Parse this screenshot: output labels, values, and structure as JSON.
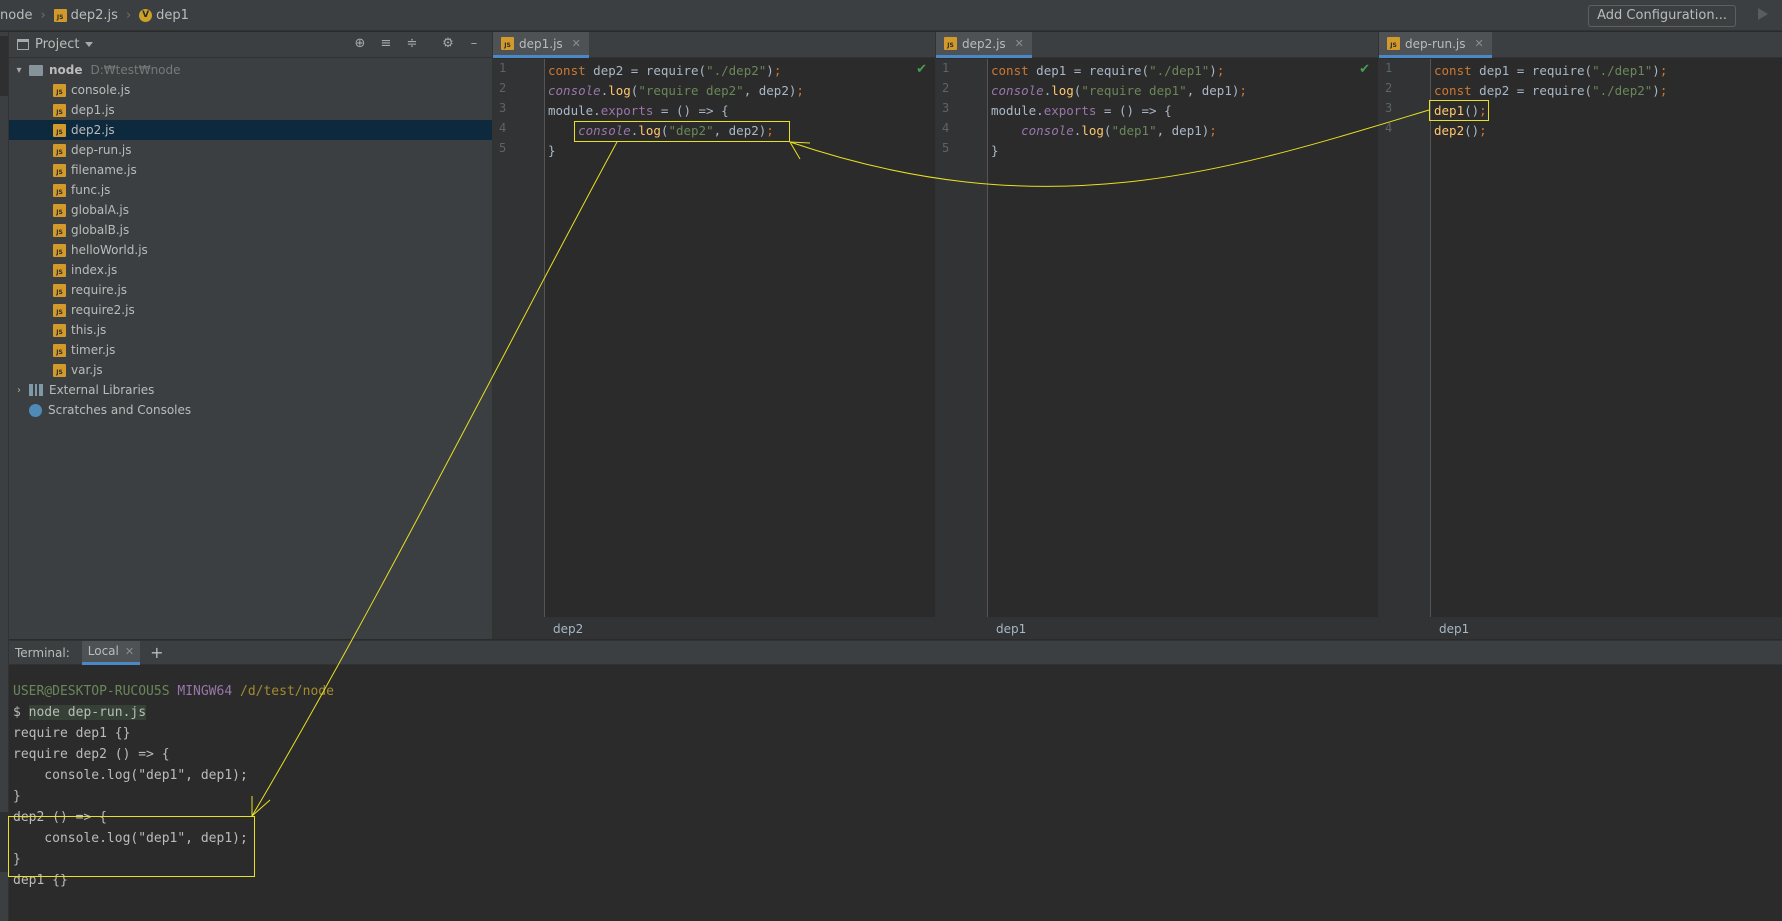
{
  "nav": {
    "crumbs": [
      "node",
      "dep2.js",
      "dep1"
    ],
    "add_config": "Add Configuration..."
  },
  "project": {
    "title": "Project",
    "root": "node",
    "root_path": "D:₩test₩node",
    "files": [
      "console.js",
      "dep1.js",
      "dep2.js",
      "dep-run.js",
      "filename.js",
      "func.js",
      "globalA.js",
      "globalB.js",
      "helloWorld.js",
      "index.js",
      "require.js",
      "require2.js",
      "this.js",
      "timer.js",
      "var.js"
    ],
    "selected_file": "dep2.js",
    "external": "External Libraries",
    "scratches": "Scratches and Consoles"
  },
  "editors": [
    {
      "tab": "dep1.js",
      "breadcrumb": "dep2",
      "line_numbers": [
        "1",
        "2",
        "3",
        "4",
        "5"
      ],
      "lines": [
        "const dep2 = require(\"./dep2\");",
        "console.log(\"require dep2\", dep2);",
        "module.exports = () => {",
        "    console.log(\"dep2\", dep2);",
        "}"
      ]
    },
    {
      "tab": "dep2.js",
      "breadcrumb": "dep1",
      "line_numbers": [
        "1",
        "2",
        "3",
        "4",
        "5"
      ],
      "lines": [
        "const dep1 = require(\"./dep1\");",
        "console.log(\"require dep1\", dep1);",
        "module.exports = () => {",
        "    console.log(\"dep1\", dep1);",
        "}"
      ]
    },
    {
      "tab": "dep-run.js",
      "breadcrumb": "dep1",
      "line_numbers": [
        "1",
        "2",
        "3",
        "4"
      ],
      "lines": [
        "const dep1 = require(\"./dep1\");",
        "const dep2 = require(\"./dep2\");",
        "dep1();",
        "dep2();"
      ]
    }
  ],
  "terminal": {
    "label": "Terminal:",
    "tab": "Local",
    "prompt_user": "USER@DESKTOP-RUCOU5S",
    "prompt_host": "MINGW64",
    "prompt_path": "/d/test/node",
    "prompt_symbol": "$",
    "command": "node dep-run.js",
    "output": [
      "require dep1 {}",
      "require dep2 () => {",
      "    console.log(\"dep1\", dep1);",
      "}",
      "dep2 () => {",
      "    console.log(\"dep1\", dep1);",
      "}",
      "dep1 {}"
    ]
  },
  "colors": {
    "annotation": "#e8e020",
    "selection": "#0d293e",
    "accent": "#4a88c7"
  }
}
